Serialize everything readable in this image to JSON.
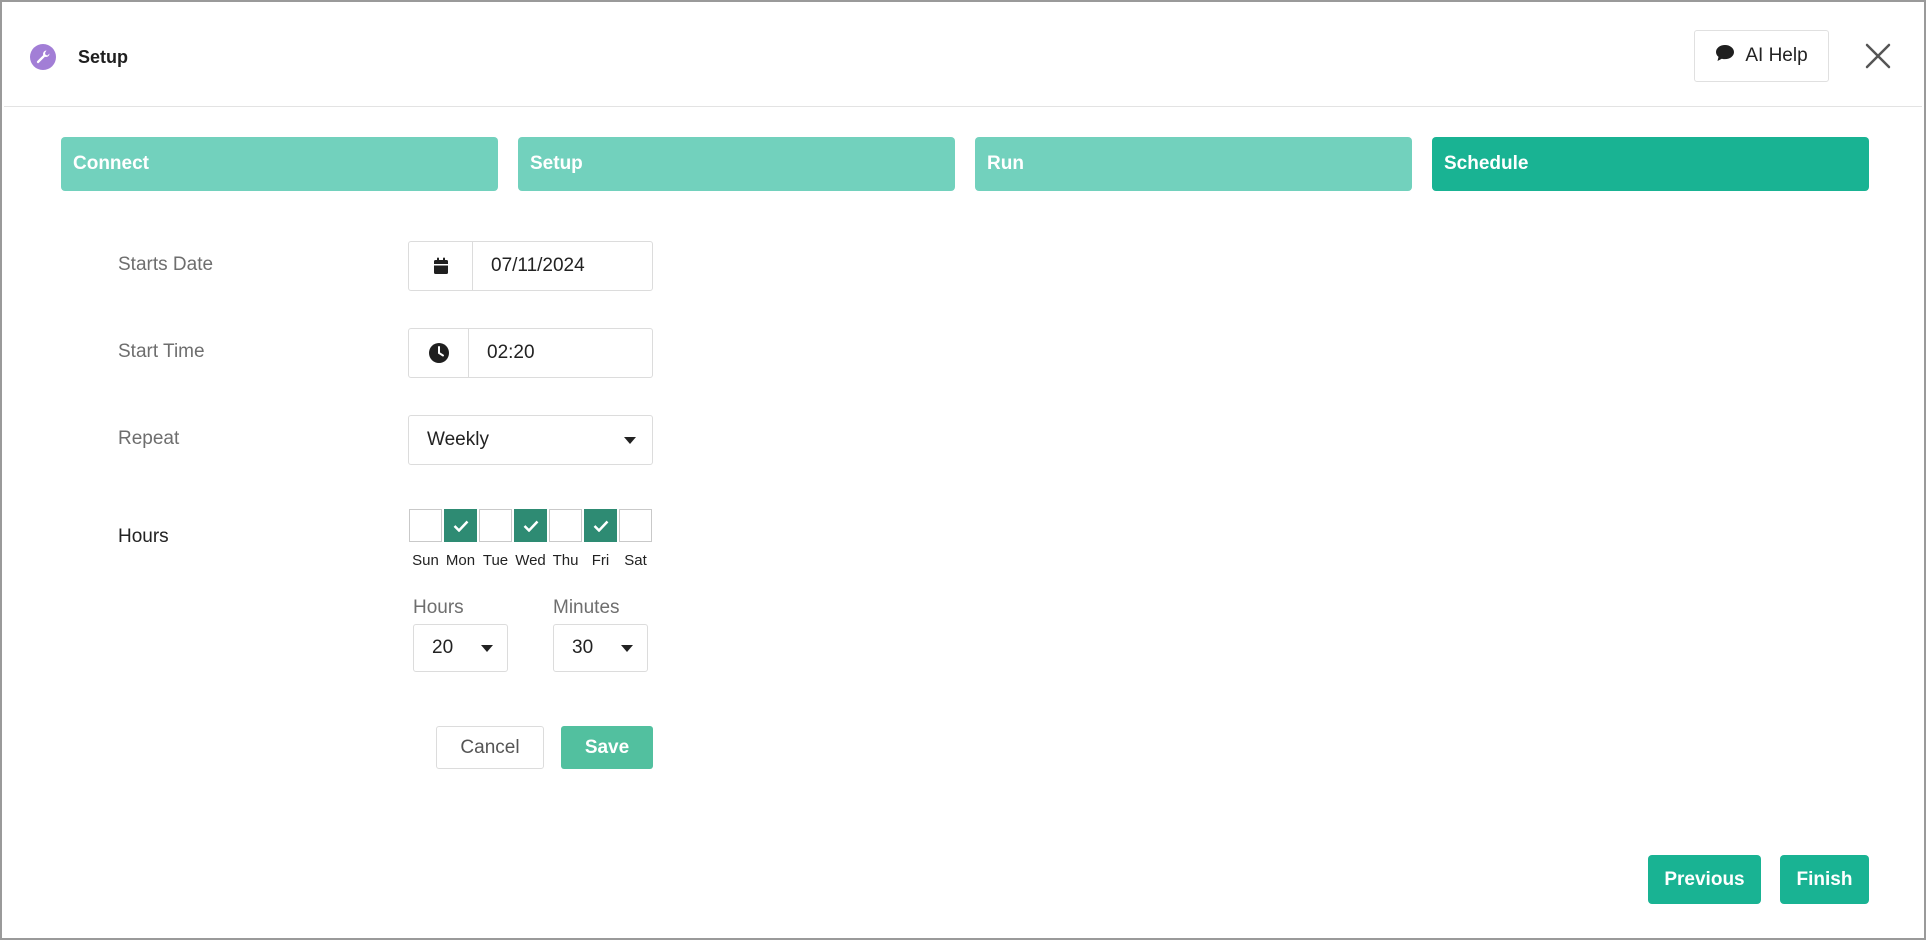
{
  "header": {
    "title": "Setup",
    "icon": "wrench-icon",
    "ai_help_label": "AI Help",
    "accent": "#a27ed6"
  },
  "steps": [
    {
      "label": "Connect",
      "active": false
    },
    {
      "label": "Setup",
      "active": false
    },
    {
      "label": "Run",
      "active": false
    },
    {
      "label": "Schedule",
      "active": true
    }
  ],
  "form": {
    "start_date": {
      "label": "Starts Date",
      "value": "07/11/2024"
    },
    "start_time": {
      "label": "Start Time",
      "value": "02:20"
    },
    "repeat": {
      "label": "Repeat",
      "value": "Weekly"
    },
    "hours": {
      "label": "Hours",
      "days": [
        {
          "label": "Sun",
          "checked": false
        },
        {
          "label": "Mon",
          "checked": true
        },
        {
          "label": "Tue",
          "checked": false
        },
        {
          "label": "Wed",
          "checked": true
        },
        {
          "label": "Thu",
          "checked": false
        },
        {
          "label": "Fri",
          "checked": true
        },
        {
          "label": "Sat",
          "checked": false
        }
      ],
      "hours_label": "Hours",
      "hours_value": "20",
      "minutes_label": "Minutes",
      "minutes_value": "30"
    },
    "cancel_label": "Cancel",
    "save_label": "Save"
  },
  "footer": {
    "previous_label": "Previous",
    "finish_label": "Finish"
  },
  "colors": {
    "step_inactive": "#72d1bd",
    "step_active": "#19b393",
    "checkbox_checked": "#2e8b73",
    "save_button": "#52c09f"
  }
}
